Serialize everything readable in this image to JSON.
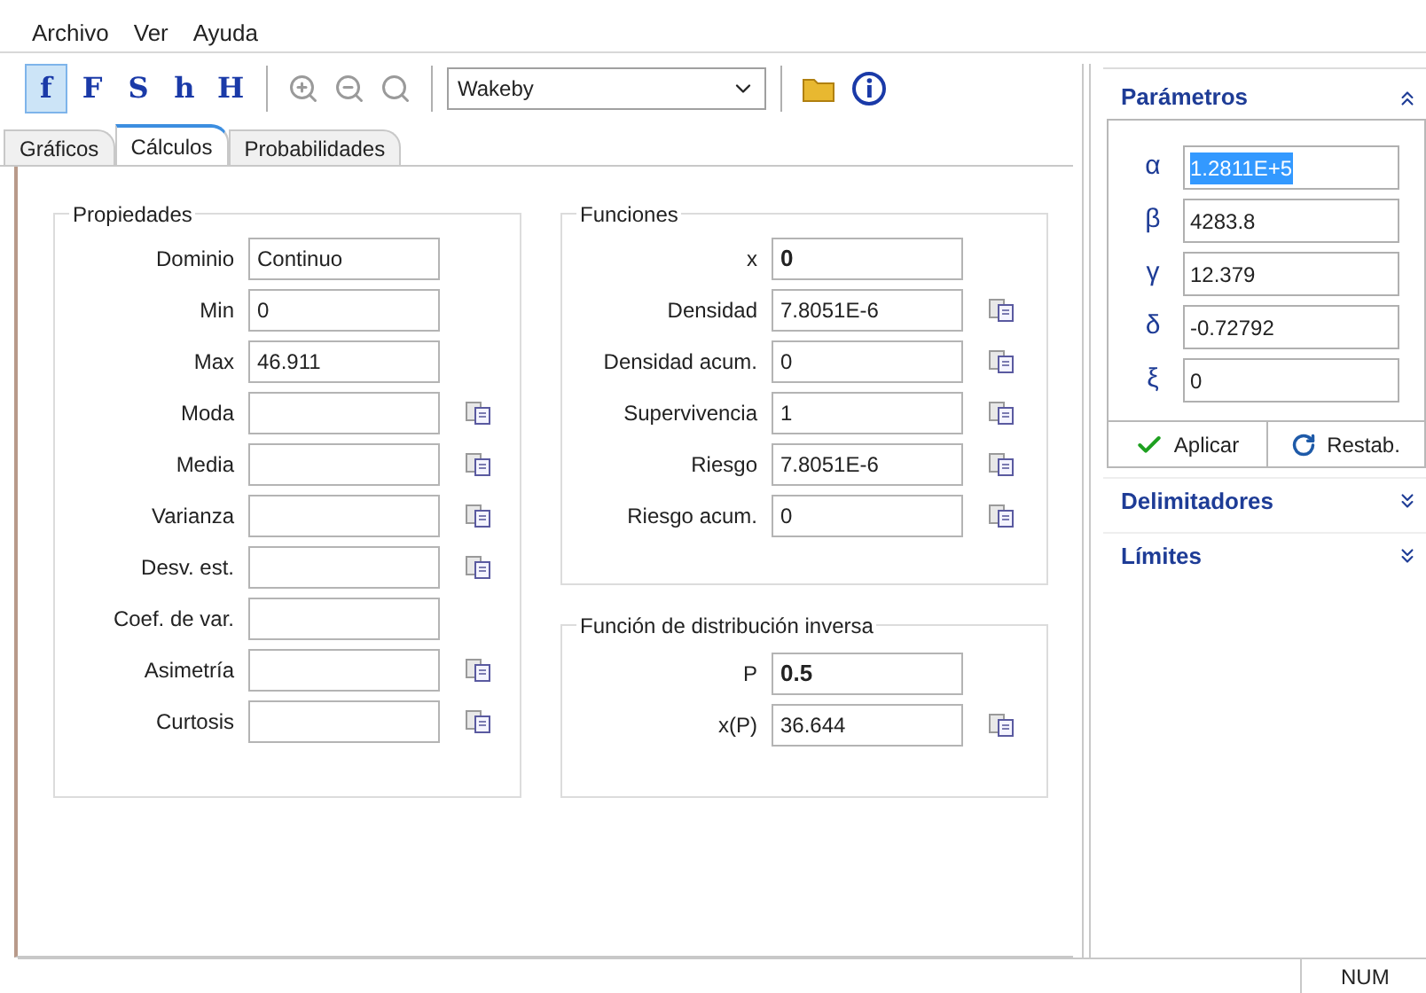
{
  "menu": [
    "Archivo",
    "Ver",
    "Ayuda"
  ],
  "toolbar": {
    "function_buttons": [
      {
        "label": "f",
        "selected": true
      },
      {
        "label": "F",
        "selected": false
      },
      {
        "label": "S",
        "selected": false
      },
      {
        "label": "h",
        "selected": false
      },
      {
        "label": "H",
        "selected": false
      }
    ],
    "distribution": "Wakeby"
  },
  "tabs": [
    {
      "label": "Gráficos",
      "selected": false
    },
    {
      "label": "Cálculos",
      "selected": true
    },
    {
      "label": "Probabilidades",
      "selected": false
    }
  ],
  "properties": {
    "title": "Propiedades",
    "rows": [
      {
        "label": "Dominio",
        "value": "Continuo",
        "copy": false
      },
      {
        "label": "Min",
        "value": "0",
        "copy": false
      },
      {
        "label": "Max",
        "value": "46.911",
        "copy": false
      },
      {
        "label": "Moda",
        "copy": true
      },
      {
        "label": "Media",
        "copy": true
      },
      {
        "label": "Varianza",
        "copy": true
      },
      {
        "label": "Desv. est.",
        "copy": true
      },
      {
        "label": "Coef. de var.",
        "copy": false
      },
      {
        "label": "Asimetría",
        "copy": true
      },
      {
        "label": "Curtosis",
        "copy": true
      }
    ]
  },
  "functions": {
    "title": "Funciones",
    "rows": [
      {
        "label": "x",
        "value": "0",
        "emphasis": true,
        "copy": false
      },
      {
        "label": "Densidad",
        "value": "7.8051E-6",
        "emphasis": false,
        "copy": true
      },
      {
        "label": "Densidad acum.",
        "value": "0",
        "emphasis": false,
        "copy": true
      },
      {
        "label": "Supervivencia",
        "value": "1",
        "emphasis": false,
        "copy": true
      },
      {
        "label": "Riesgo",
        "value": "7.8051E-6",
        "emphasis": false,
        "copy": true
      },
      {
        "label": "Riesgo acum.",
        "value": "0",
        "emphasis": false,
        "copy": true
      }
    ]
  },
  "inverse": {
    "title": "Función de distribución inversa",
    "rows": [
      {
        "label": "P",
        "value": "0.5",
        "emphasis": true,
        "copy": false
      },
      {
        "label": "x(P)",
        "value": "36.644",
        "emphasis": false,
        "copy": true
      }
    ]
  },
  "parameters": {
    "title": "Parámetros",
    "expanded": true,
    "params": [
      {
        "symbol": "α",
        "value": "1.2811E+5",
        "selected": true
      },
      {
        "symbol": "β",
        "value": "4283.8",
        "selected": false
      },
      {
        "symbol": "γ",
        "value": "12.379",
        "selected": false
      },
      {
        "symbol": "δ",
        "value": "-0.72792",
        "selected": false
      },
      {
        "symbol": "ξ",
        "value": "0",
        "selected": false
      }
    ],
    "buttons": [
      {
        "kind": "apply",
        "label": "Aplicar"
      },
      {
        "kind": "reset",
        "label": "Restab."
      }
    ]
  },
  "sections": [
    {
      "title": "Delimitadores",
      "expanded": false
    },
    {
      "title": "Límites",
      "expanded": false
    }
  ],
  "status_bar": {
    "indicator": "NUM"
  }
}
